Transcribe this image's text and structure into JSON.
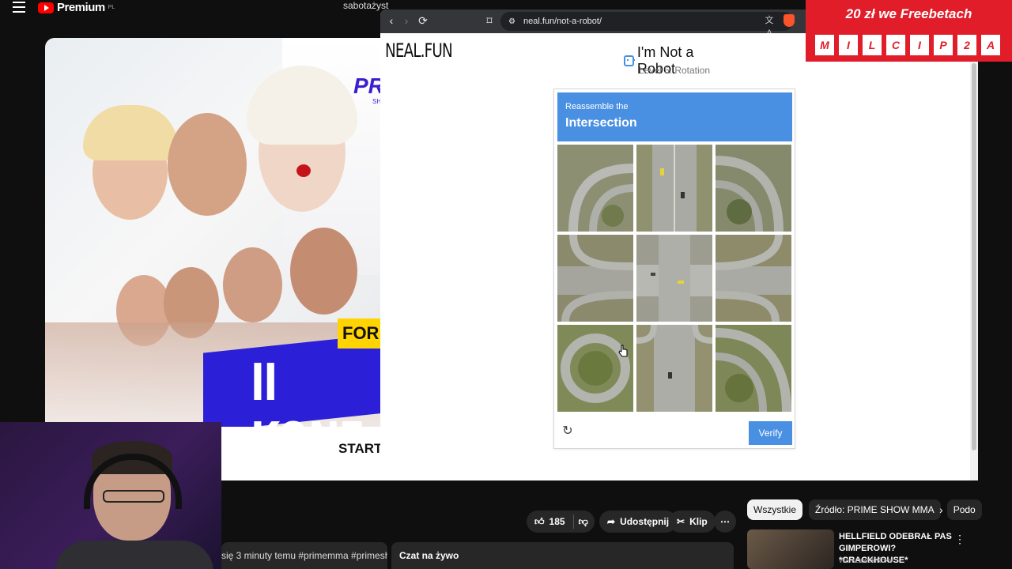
{
  "youtube": {
    "logo_text": "Premium",
    "logo_superscript": "PL",
    "search_chip": "sabotażyst",
    "thumbnail_title": "II KONF",
    "thumbnail_badge": "FOR",
    "thumbnail_brand": "PR",
    "thumbnail_brand_sub": "SH",
    "thumbnail_bottom": "START ZA",
    "meta_text": "się 3 minuty temu  #primemma #primeshowmm",
    "chat_tab": "Czat na żywo",
    "likes": "185",
    "share_label": "Udostępnij",
    "clip_label": "Klip",
    "chips": [
      "Wszystkie",
      "Źródło: PRIME SHOW MMA",
      "Podo"
    ],
    "rec_title": "HELLFIELD ODEBRAŁ PAS GIMPEROWI? *CRACKHOUSE*",
    "rec_channel": "WarszawskiKoks"
  },
  "browser": {
    "url": "neal.fun/not-a-robot/"
  },
  "page": {
    "logo": "NEAL.FUN",
    "title": "I'm Not a Robot",
    "level": "Level 5: Rotation",
    "captcha": {
      "subtitle": "Reassemble the",
      "target": "Intersection",
      "verify_label": "Verify"
    }
  },
  "promo": {
    "title": "20 zł we Freebetach",
    "letters": [
      "M",
      "I",
      "L",
      "C",
      "I",
      "P",
      "2",
      "A"
    ]
  },
  "colors": {
    "captcha_blue": "#4a90e2",
    "promo_red": "#e11d2a",
    "yt_red": "#ff0000"
  }
}
